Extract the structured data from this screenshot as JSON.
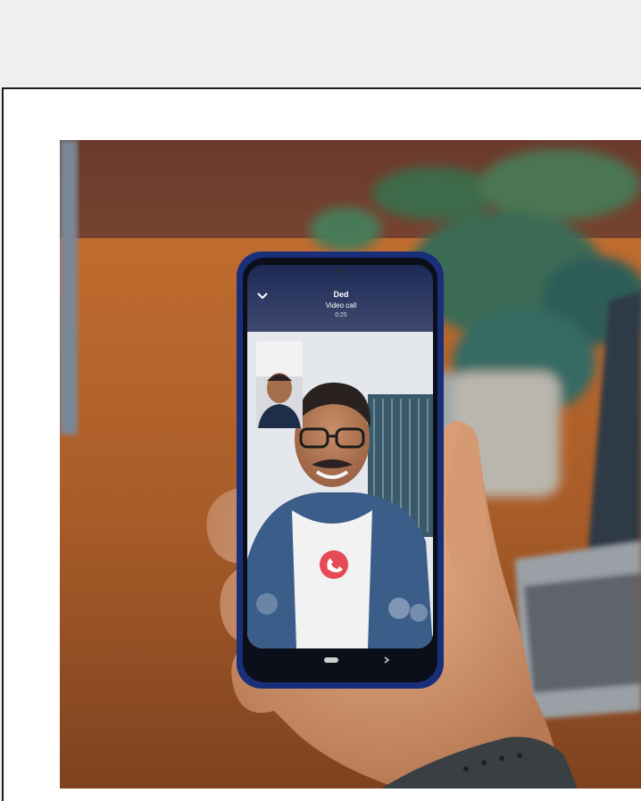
{
  "call_screen": {
    "caller_label": "Ded",
    "caller_sublabel": "Video call",
    "status": "0:25"
  },
  "colors": {
    "frame_border": "#1a1a1a",
    "end_call_button": "#e64a55",
    "phone_body": "#1a2f7a"
  },
  "icons": {
    "collapse": "chevron-down-icon",
    "end_call": "phone-hangup-icon",
    "nav_home": "home-pill-icon"
  }
}
